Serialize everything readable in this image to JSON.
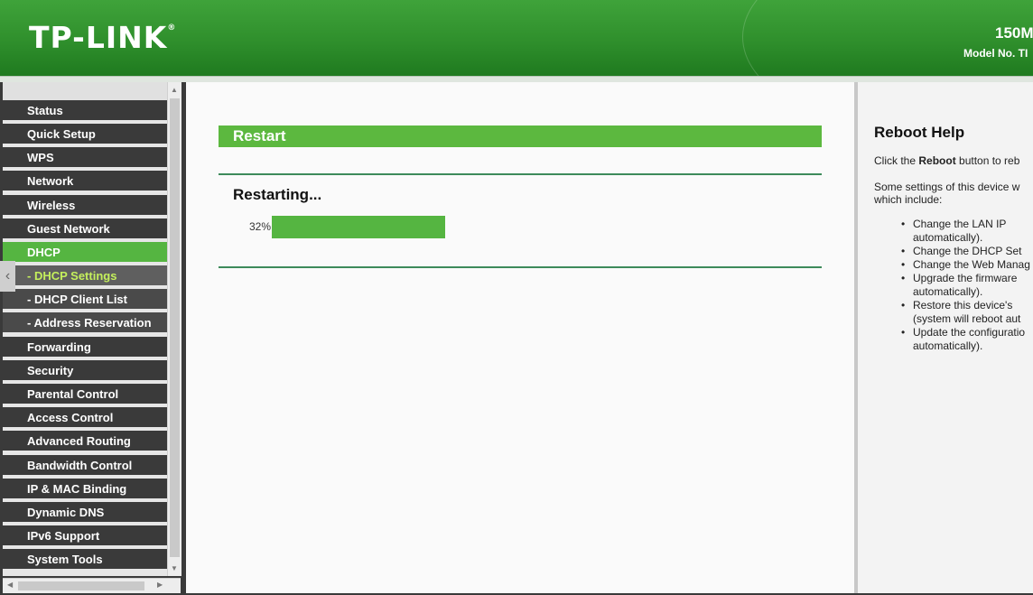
{
  "header": {
    "logo_text": "TP-LINK",
    "logo_mark": "®",
    "model_title": "150M",
    "model_no": "Model No. TI"
  },
  "sidebar": {
    "items": [
      {
        "label": "Status"
      },
      {
        "label": "Quick Setup"
      },
      {
        "label": "WPS"
      },
      {
        "label": "Network"
      },
      {
        "label": "Wireless"
      },
      {
        "label": "Guest Network"
      },
      {
        "label": "DHCP"
      },
      {
        "label": "- DHCP Settings"
      },
      {
        "label": "- DHCP Client List"
      },
      {
        "label": "- Address Reservation"
      },
      {
        "label": "Forwarding"
      },
      {
        "label": "Security"
      },
      {
        "label": "Parental Control"
      },
      {
        "label": "Access Control"
      },
      {
        "label": "Advanced Routing"
      },
      {
        "label": "Bandwidth Control"
      },
      {
        "label": "IP & MAC Binding"
      },
      {
        "label": "Dynamic DNS"
      },
      {
        "label": "IPv6 Support"
      },
      {
        "label": "System Tools"
      }
    ],
    "collapse_arrow": "‹"
  },
  "main": {
    "section_title": "Restart",
    "status_text": "Restarting...",
    "progress_label": "32%",
    "progress_fraction": 0.32,
    "accent_color": "#55b541"
  },
  "help": {
    "title": "Reboot Help",
    "intro_before": "Click the ",
    "intro_bold": "Reboot",
    "intro_after": " button to reb",
    "settings_line1": "Some settings of this device w",
    "settings_line2": "which include:",
    "items": [
      {
        "line1": "Change the LAN IP",
        "line2": "automatically)."
      },
      {
        "line1": "Change the DHCP Set"
      },
      {
        "line1": "Change the Web Manag"
      },
      {
        "line1": "Upgrade the firmware",
        "line2": "automatically)."
      },
      {
        "line1": "Restore this device's",
        "line2": "(system will reboot aut"
      },
      {
        "line1": "Update the configuratio",
        "line2": "automatically)."
      }
    ]
  }
}
